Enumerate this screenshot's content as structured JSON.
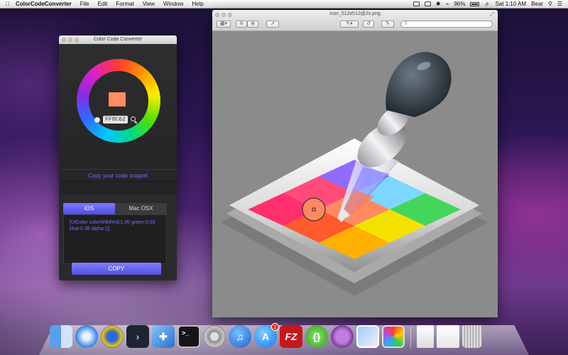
{
  "menubar": {
    "app_name": "ColorCodeConverter",
    "menus": [
      "File",
      "Edit",
      "Format",
      "View",
      "Window",
      "Help"
    ],
    "battery": "96%",
    "clock": "Sat 1:10 AM",
    "user": "Bear"
  },
  "converter": {
    "title": "Color Code Converter",
    "hex_value": "FF8C62",
    "swatch_color": "#FF8C62",
    "copy_hint": "Copy your code snippet",
    "tabs": [
      {
        "label": "iOS",
        "active": true
      },
      {
        "label": "Mac OSX",
        "active": false
      }
    ],
    "code_snippet": "[UIColor colorWithRed:1.00 green:0.55 blue:0.38 alpha:1];",
    "copy_label": "COPY",
    "accent_color": "#6d6dff"
  },
  "preview": {
    "title": "icon_512x512@2x.png",
    "search_placeholder": ""
  },
  "dock": {
    "badge_count": "2",
    "items": [
      "finder-icon",
      "safari-icon",
      "textwrangler-icon",
      "xcode-dash-icon",
      "xcode-icon",
      "terminal-icon",
      "system-preferences-icon",
      "itunes-icon",
      "app-store-icon",
      "filezilla-icon",
      "json-editor-icon",
      "github-icon",
      "preview-icon",
      "color-code-converter-icon",
      "zip-archive-icon",
      "document-icon",
      "trash-icon"
    ],
    "filezilla_label": "FZ",
    "json_label": "{}"
  }
}
